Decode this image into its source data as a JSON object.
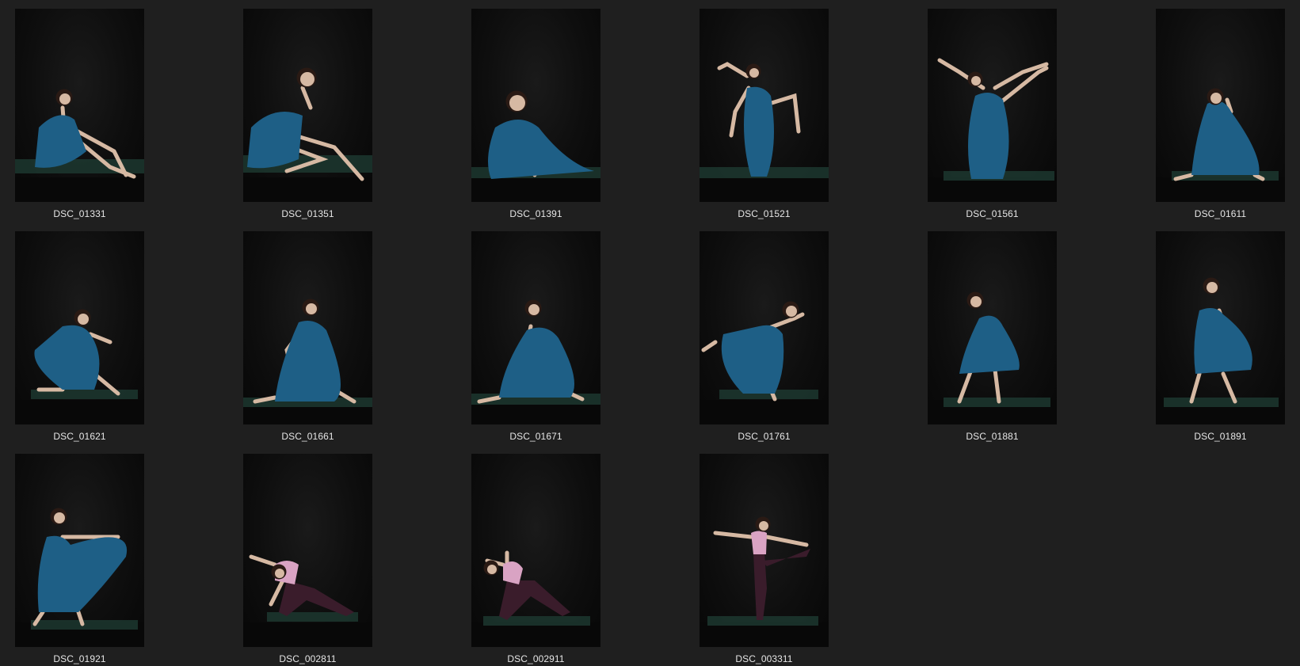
{
  "gallery": {
    "items": [
      {
        "filename": "DSC_01331",
        "outfit": "blue-dress",
        "pose": "seated-knees-up"
      },
      {
        "filename": "DSC_01351",
        "outfit": "blue-dress",
        "pose": "seated-chin-hand"
      },
      {
        "filename": "DSC_01391",
        "outfit": "blue-dress",
        "pose": "kneeling-side"
      },
      {
        "filename": "DSC_01521",
        "outfit": "blue-dress",
        "pose": "arm-arc-knee-lift"
      },
      {
        "filename": "DSC_01561",
        "outfit": "blue-dress",
        "pose": "leg-extension-high"
      },
      {
        "filename": "DSC_01611",
        "outfit": "blue-dress",
        "pose": "lunge-hand-head"
      },
      {
        "filename": "DSC_01621",
        "outfit": "blue-dress",
        "pose": "wide-lunge-skirt"
      },
      {
        "filename": "DSC_01661",
        "outfit": "blue-dress",
        "pose": "deep-lunge"
      },
      {
        "filename": "DSC_01671",
        "outfit": "blue-dress",
        "pose": "low-lunge-skirt"
      },
      {
        "filename": "DSC_01761",
        "outfit": "blue-dress",
        "pose": "arabesque-skirt"
      },
      {
        "filename": "DSC_01881",
        "outfit": "blue-dress",
        "pose": "standing-twirl"
      },
      {
        "filename": "DSC_01891",
        "outfit": "blue-dress",
        "pose": "standing-skirt-hold"
      },
      {
        "filename": "DSC_01921",
        "outfit": "blue-dress",
        "pose": "skirt-fan"
      },
      {
        "filename": "DSC_002811",
        "outfit": "pink-top",
        "pose": "side-angle"
      },
      {
        "filename": "DSC_002911",
        "outfit": "pink-top",
        "pose": "twisted-lunge"
      },
      {
        "filename": "DSC_003311",
        "outfit": "pink-top",
        "pose": "standing-leg-hold"
      }
    ]
  },
  "colors": {
    "background": "#1f1f1f",
    "caption_text": "#e6e6e6",
    "photo_backdrop": "#0c0c0c",
    "dress_blue": "#1e5f86",
    "top_pink": "#d9a3c3",
    "leggings": "#3a1c2b",
    "mat_green": "#1f3d34",
    "skin": "#d6b9a3",
    "hair": "#2a1a14"
  }
}
